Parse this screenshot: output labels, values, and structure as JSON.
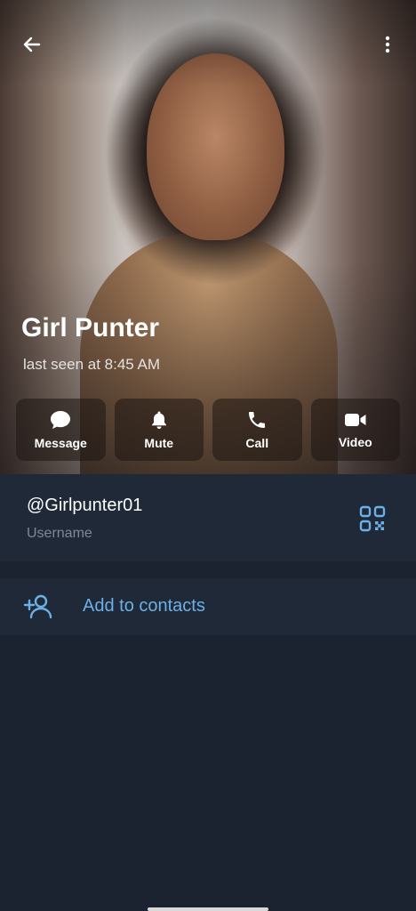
{
  "profile": {
    "name": "Girl Punter",
    "status": "last seen at 8:45 AM"
  },
  "actions": [
    {
      "label": "Message",
      "icon": "message-bubble-icon"
    },
    {
      "label": "Mute",
      "icon": "bell-icon"
    },
    {
      "label": "Call",
      "icon": "phone-icon"
    },
    {
      "label": "Video",
      "icon": "video-camera-icon"
    }
  ],
  "info": {
    "username": "@Girlpunter01",
    "username_caption": "Username"
  },
  "contacts": {
    "add_label": "Add to contacts"
  },
  "colors": {
    "background": "#1b2230",
    "card": "#1f2937",
    "accent": "#6cb0e8",
    "caption": "#7e8896"
  }
}
